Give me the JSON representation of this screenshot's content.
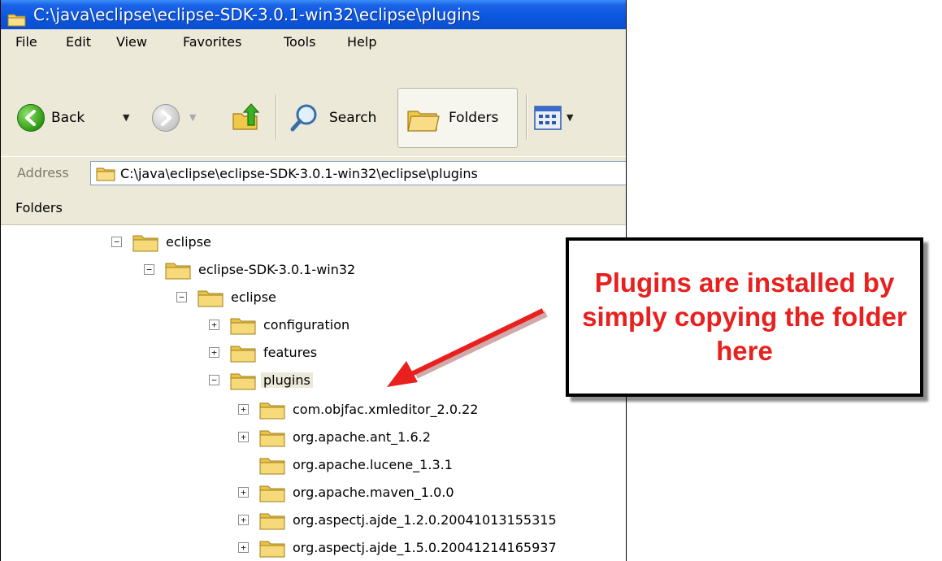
{
  "window": {
    "title": "C:\\java\\eclipse\\eclipse-SDK-3.0.1-win32\\eclipse\\plugins"
  },
  "menu": [
    "File",
    "Edit",
    "View",
    "Favorites",
    "Tools",
    "Help"
  ],
  "toolbar": {
    "back_label": "Back",
    "search_label": "Search",
    "folders_label": "Folders"
  },
  "address": {
    "label": "Address",
    "value": "C:\\java\\eclipse\\eclipse-SDK-3.0.1-win32\\eclipse\\plugins"
  },
  "folders_pane": {
    "label": "Folders"
  },
  "tree": [
    {
      "label": "eclipse",
      "expander": "minus"
    },
    {
      "label": "eclipse-SDK-3.0.1-win32",
      "expander": "minus"
    },
    {
      "label": "eclipse",
      "expander": "minus"
    },
    {
      "label": "configuration",
      "expander": "plus"
    },
    {
      "label": "features",
      "expander": "plus"
    },
    {
      "label": "plugins",
      "expander": "minus",
      "selected": true
    },
    {
      "label": "com.objfac.xmleditor_2.0.22",
      "expander": "plus"
    },
    {
      "label": "org.apache.ant_1.6.2",
      "expander": "plus"
    },
    {
      "label": "org.apache.lucene_1.3.1",
      "expander": "none"
    },
    {
      "label": "org.apache.maven_1.0.0",
      "expander": "plus"
    },
    {
      "label": "org.aspectj.ajde_1.2.0.20041013155315",
      "expander": "plus"
    },
    {
      "label": "org.aspectj.ajde_1.5.0.20041214165937",
      "expander": "plus"
    }
  ],
  "callout": {
    "text": "Plugins are installed by simply copying the folder here",
    "color": "#e8201e"
  },
  "colors": {
    "titlebar": "#0a56e0",
    "chrome": "#ece9d8",
    "folder": "#f2d064"
  }
}
